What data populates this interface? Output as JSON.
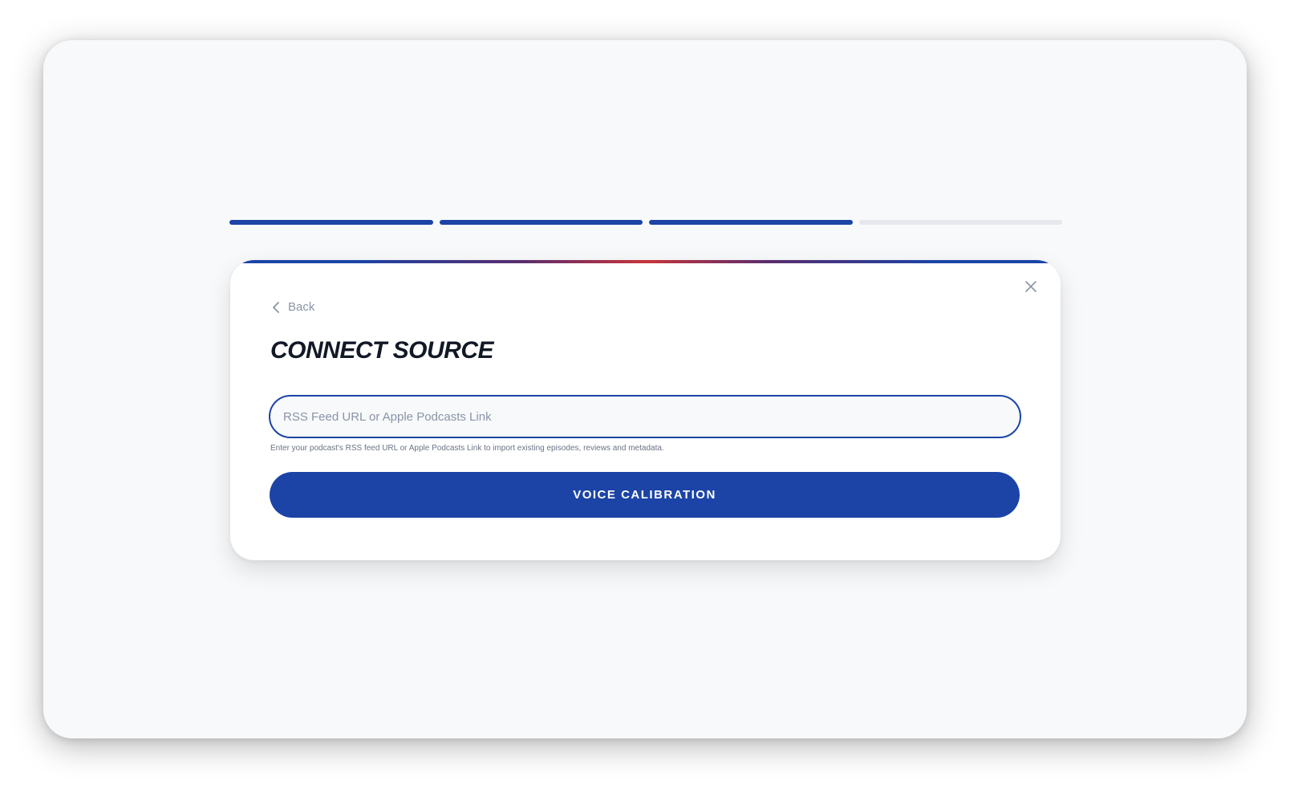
{
  "stepper": {
    "total_steps": 4,
    "completed_steps": 3,
    "active_color": "#1b44a6",
    "inactive_color": "#e6e8ec"
  },
  "modal": {
    "back_label": "Back",
    "title": "CONNECT SOURCE",
    "input_placeholder": "RSS Feed URL or Apple Podcasts Link",
    "input_value": "",
    "helper_text": "Enter your podcast's RSS feed URL or Apple Podcasts Link to import existing episodes, reviews and metadata.",
    "primary_button_label": "VOICE CALIBRATION",
    "close_icon": "close-icon",
    "back_icon": "chevron-left-icon"
  },
  "colors": {
    "accent": "#1b44a6",
    "gradient_mid": "#c6343a",
    "title": "#121826",
    "muted": "#8a94a8"
  }
}
